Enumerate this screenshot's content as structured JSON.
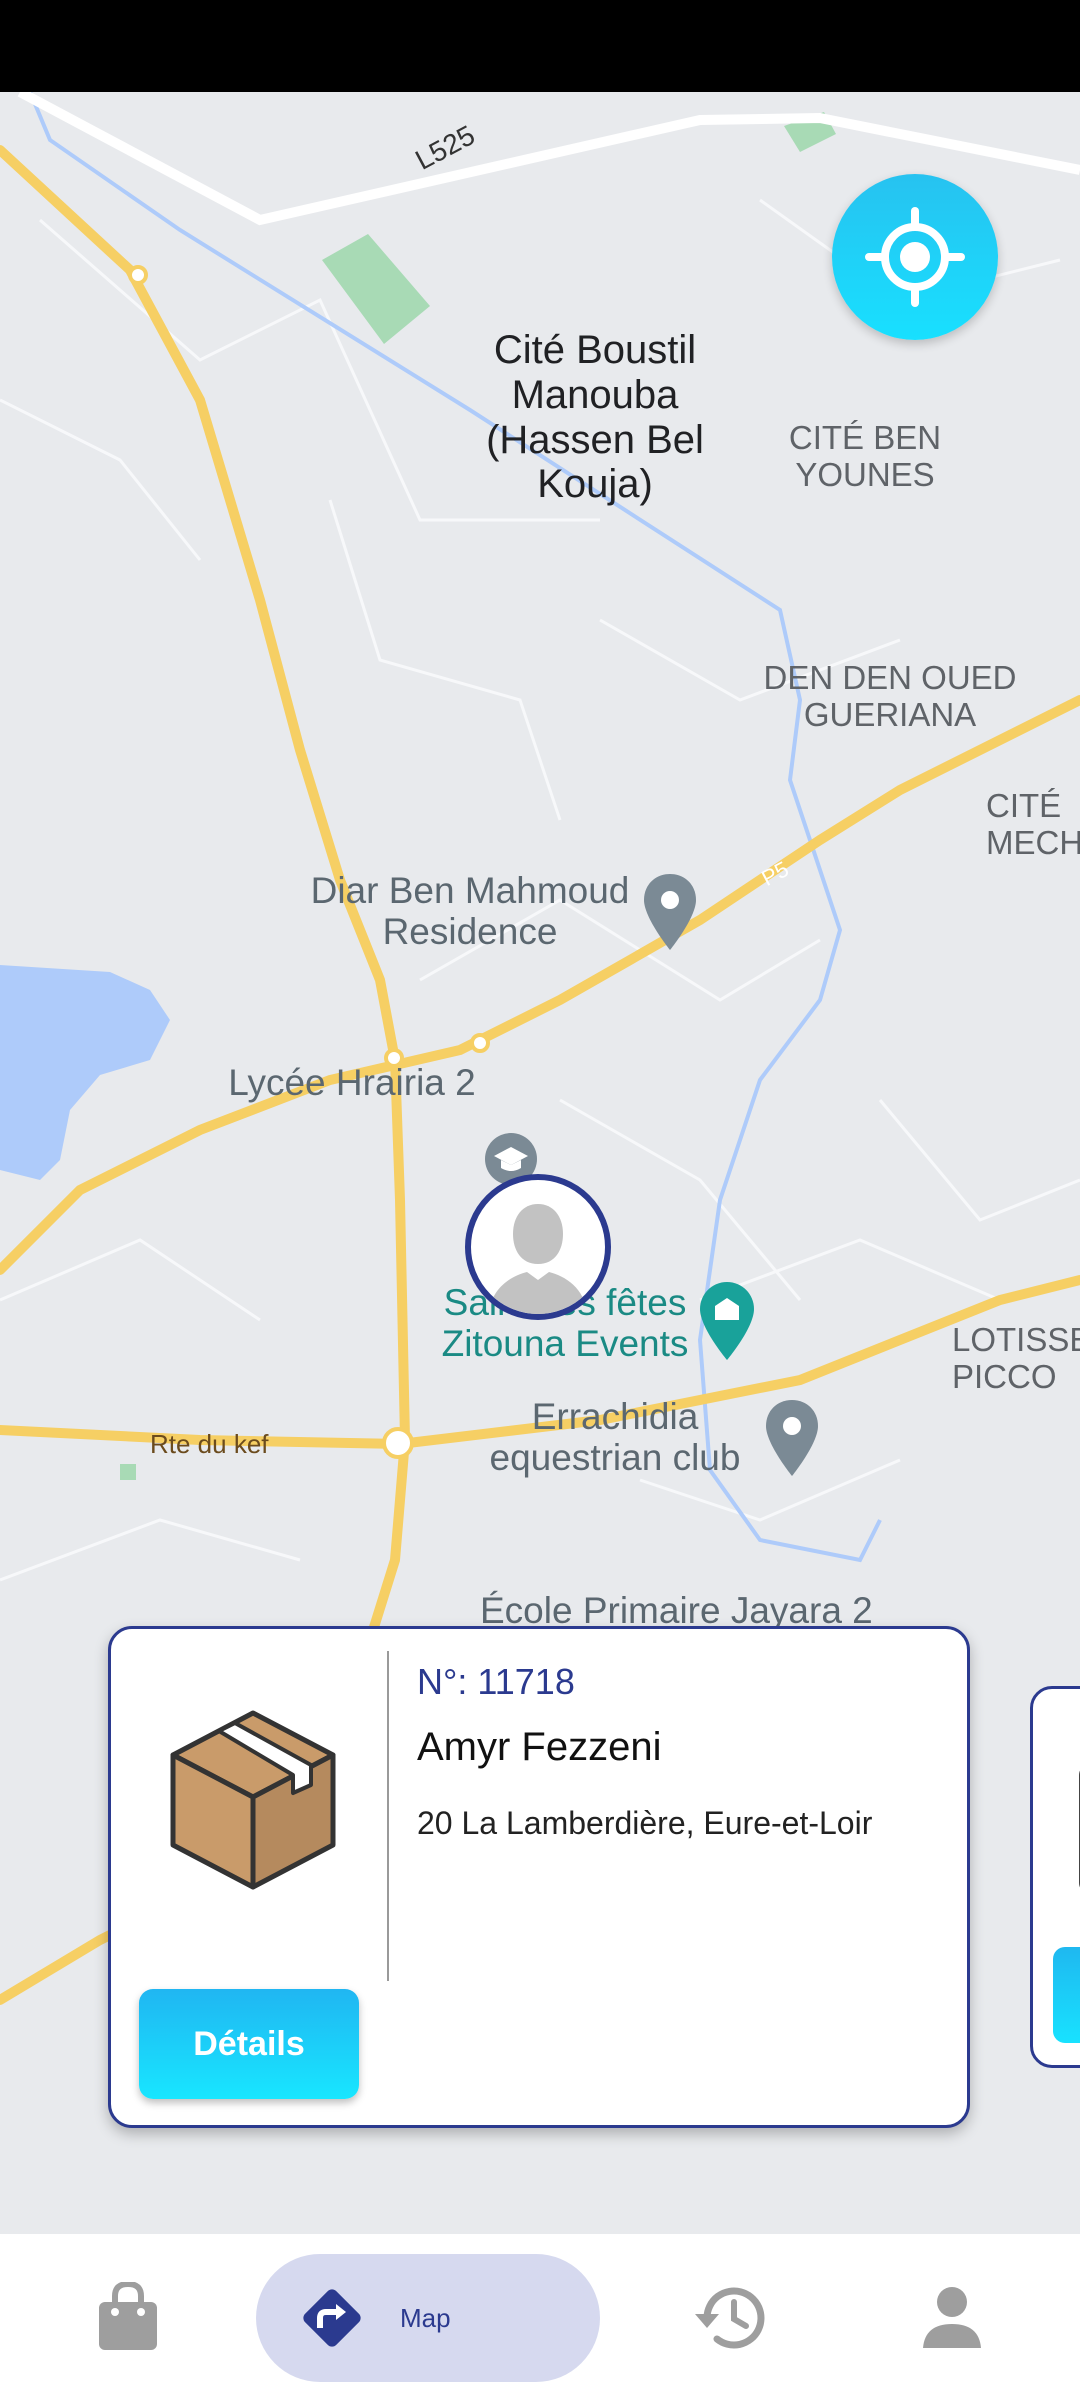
{
  "map": {
    "labels": {
      "road_l525": "L525",
      "cite_boustil": "Cité Boustil Manouba (Hassen Bel Kouja)",
      "cite_ben_younes": "CITÉ BEN YOUNES",
      "den_den": "DEN DEN OUED GUERIANA",
      "cite_mech": "CITÉ MECH",
      "diar_ben_mahmoud": "Diar Ben Mahmoud Residence",
      "lycee": "Lycée Hrairia 2",
      "salle": "Salle des fêtes Zitouna Events",
      "errachidia": "Errachidia equestrian club",
      "lotisse": "LOTISSE PICCO",
      "rte_du_kef": "Rte du kef",
      "ecole": "École Primaire Jayara 2",
      "road_p5": "P5"
    }
  },
  "colors": {
    "accent": "#18e0ff",
    "brand_navy": "#2b3a8f",
    "road": "#f6cf64",
    "water": "#aecbfa",
    "park": "#a8dab5"
  },
  "delivery_card": {
    "order_number": "N°: 11718",
    "customer_name": "Amyr Fezzeni",
    "address": "20 La Lamberdière, Eure-et-Loir",
    "details_button": "Détails",
    "icon": "package-box-icon"
  },
  "bottom_nav": {
    "items": [
      {
        "name": "orders",
        "icon": "shopping-bag-icon",
        "label": ""
      },
      {
        "name": "map",
        "icon": "directions-icon",
        "label": "Map"
      },
      {
        "name": "history",
        "icon": "history-icon",
        "label": ""
      },
      {
        "name": "profile",
        "icon": "person-icon",
        "label": ""
      }
    ],
    "active": "map"
  }
}
